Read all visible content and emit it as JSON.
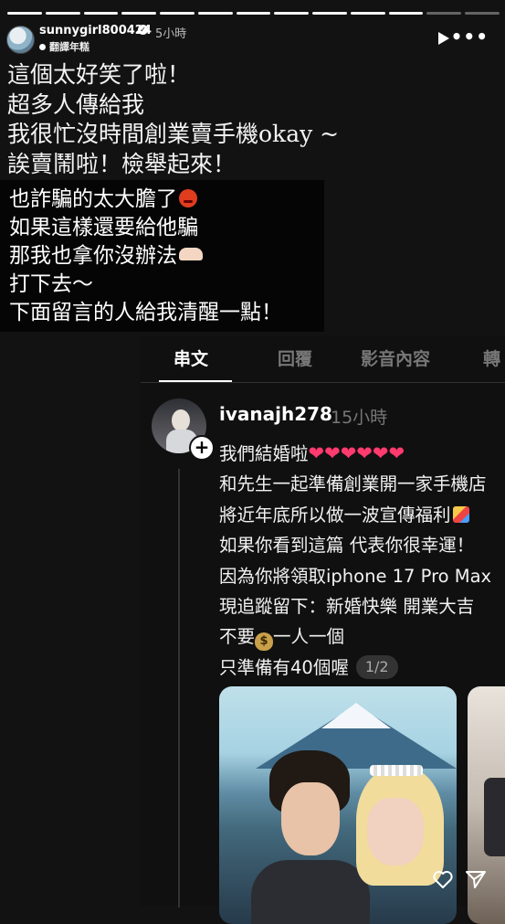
{
  "story": {
    "segments_total": 13,
    "segments_viewed": 11
  },
  "header": {
    "username": "sunnygirl800424",
    "time": "5小時",
    "translate_label": "翻譯年糕"
  },
  "caption_top": [
    "這個太好笑了啦！",
    "超多人傳給我",
    "我很忙沒時間創業賣手機okay ~",
    "誒賣鬧啦！檢舉起來！"
  ],
  "caption_box": {
    "line1": "也詐騙的太大膽了",
    "line2": "如果這樣還要給他騙",
    "line3": "那我也拿你沒辦法",
    "line4": "打下去～",
    "line5": "下面留言的人給我清醒一點！"
  },
  "tabs": [
    "串文",
    "回覆",
    "影音內容",
    "轉"
  ],
  "post": {
    "username": "ivanajh278",
    "time": "15小時",
    "lines": {
      "l1": "我們結婚啦",
      "l1_hearts": "❤❤❤❤❤❤",
      "l2": "和先生一起準備創業開一家手機店",
      "l3": "將近年底所以做一波宣傳福利",
      "l4": "如果你看到這篇 代表你很幸運！",
      "l5": "因為你將領取iphone 17 Pro Max",
      "l6": "現追蹤留下：新婚快樂 開業大吉",
      "l7a": "不要",
      "l7b": "一人一個",
      "l8": "只準備有40個喔"
    },
    "page_indicator": "1/2"
  },
  "icons": [
    "verified-icon",
    "play-icon",
    "more-icon",
    "heart-icon",
    "send-icon",
    "add-icon"
  ],
  "colors": {
    "background": "#121212",
    "heart": "#ff3a6e"
  }
}
